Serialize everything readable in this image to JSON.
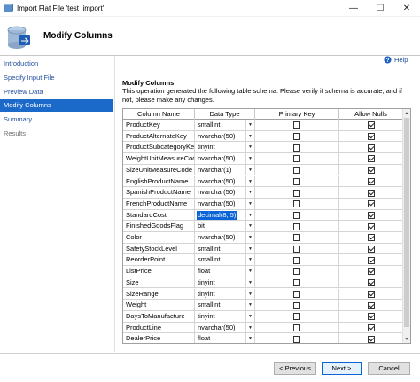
{
  "window": {
    "title": "Import Flat File 'test_import'",
    "minimize": "—",
    "maximize": "☐",
    "close": "✕"
  },
  "header": {
    "title": "Modify Columns"
  },
  "nav": {
    "items": [
      {
        "label": "Introduction",
        "state": "link"
      },
      {
        "label": "Specify Input File",
        "state": "link"
      },
      {
        "label": "Preview Data",
        "state": "link"
      },
      {
        "label": "Modify Columns",
        "state": "active"
      },
      {
        "label": "Summary",
        "state": "link"
      },
      {
        "label": "Results",
        "state": "disabled"
      }
    ]
  },
  "help": {
    "label": "Help"
  },
  "content": {
    "section_title": "Modify Columns",
    "description": "This operation generated the following table schema. Please verify if schema is accurate, and if not, please make any changes."
  },
  "grid": {
    "headers": {
      "name": "Column Name",
      "type": "Data Type",
      "pk": "Primary Key",
      "nulls": "Allow Nulls"
    },
    "dropdown_glyph": "▼",
    "rows": [
      {
        "name": "ProductKey",
        "type": "smallint",
        "pk": false,
        "nulls": true,
        "selected": false
      },
      {
        "name": "ProductAlternateKey",
        "type": "nvarchar(50)",
        "pk": false,
        "nulls": true,
        "selected": false
      },
      {
        "name": "ProductSubcategoryKey",
        "type": "tinyint",
        "pk": false,
        "nulls": true,
        "selected": false
      },
      {
        "name": "WeightUnitMeasureCode",
        "type": "nvarchar(50)",
        "pk": false,
        "nulls": true,
        "selected": false
      },
      {
        "name": "SizeUnitMeasureCode",
        "type": "nvarchar(1)",
        "pk": false,
        "nulls": true,
        "selected": false
      },
      {
        "name": "EnglishProductName",
        "type": "nvarchar(50)",
        "pk": false,
        "nulls": true,
        "selected": false
      },
      {
        "name": "SpanishProductName",
        "type": "nvarchar(50)",
        "pk": false,
        "nulls": true,
        "selected": false
      },
      {
        "name": "FrenchProductName",
        "type": "nvarchar(50)",
        "pk": false,
        "nulls": true,
        "selected": false
      },
      {
        "name": "StandardCost",
        "type": "decimal(8, 5)",
        "pk": false,
        "nulls": true,
        "selected": true
      },
      {
        "name": "FinishedGoodsFlag",
        "type": "bit",
        "pk": false,
        "nulls": true,
        "selected": false
      },
      {
        "name": "Color",
        "type": "nvarchar(50)",
        "pk": false,
        "nulls": true,
        "selected": false
      },
      {
        "name": "SafetyStockLevel",
        "type": "smallint",
        "pk": false,
        "nulls": true,
        "selected": false
      },
      {
        "name": "ReorderPoint",
        "type": "smallint",
        "pk": false,
        "nulls": true,
        "selected": false
      },
      {
        "name": "ListPrice",
        "type": "float",
        "pk": false,
        "nulls": true,
        "selected": false
      },
      {
        "name": "Size",
        "type": "tinyint",
        "pk": false,
        "nulls": true,
        "selected": false
      },
      {
        "name": "SizeRange",
        "type": "tinyint",
        "pk": false,
        "nulls": true,
        "selected": false
      },
      {
        "name": "Weight",
        "type": "smallint",
        "pk": false,
        "nulls": true,
        "selected": false
      },
      {
        "name": "DaysToManufacture",
        "type": "tinyint",
        "pk": false,
        "nulls": true,
        "selected": false
      },
      {
        "name": "ProductLine",
        "type": "nvarchar(50)",
        "pk": false,
        "nulls": true,
        "selected": false
      },
      {
        "name": "DealerPrice",
        "type": "float",
        "pk": false,
        "nulls": true,
        "selected": false
      }
    ]
  },
  "buttons": {
    "previous": "< Previous",
    "next": "Next >",
    "cancel": "Cancel"
  },
  "colors": {
    "accent": "#1b6ac9",
    "link": "#1f4e9c",
    "selection": "#0a64d8"
  }
}
